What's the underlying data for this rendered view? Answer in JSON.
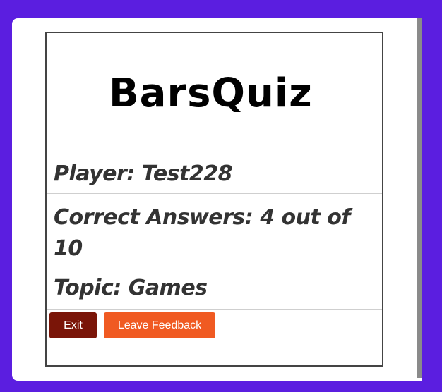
{
  "app": {
    "logo_text": "BarsQuiz!"
  },
  "results": {
    "player": "Player: Test228",
    "correct": "Correct Answers: 4 out of 10",
    "topic": "Topic: Games"
  },
  "actions": {
    "exit_label": "Exit",
    "feedback_label": "Leave Feedback"
  },
  "colors": {
    "page_background": "#5b1ee0",
    "exit_button": "#7a1508",
    "feedback_button": "#f05a22",
    "text": "#333333"
  }
}
